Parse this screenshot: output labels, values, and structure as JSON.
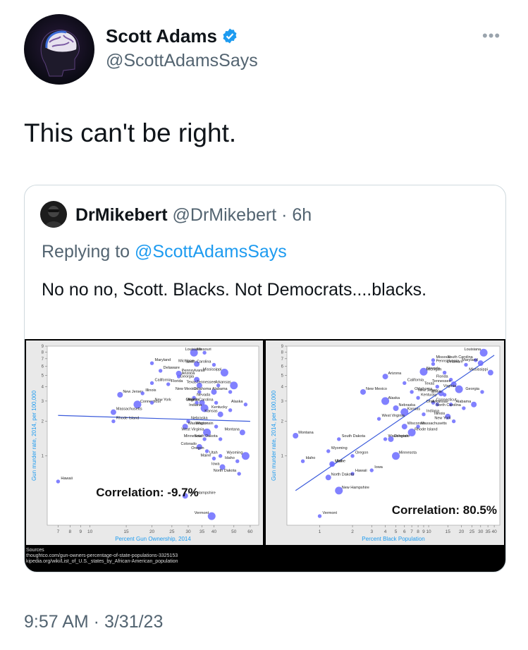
{
  "author": {
    "name": "Scott Adams",
    "handle": "@ScottAdamsSays"
  },
  "tweet": {
    "text": "This can't be right.",
    "timestamp": "9:57 AM · 3/31/23"
  },
  "more_label": "•••",
  "quote": {
    "name": "DrMikebert",
    "handle": "@DrMikebert · 6h",
    "reply_prefix": "Replying to ",
    "reply_mention": "@ScottAdamsSays",
    "text": "No no no, Scott. Blacks. Not Democrats....blacks."
  },
  "colors": {
    "accent": "#1d9bf0",
    "verified": "#1d9bf0",
    "point": "#6b6bff",
    "line": "#3b5bdb"
  },
  "sources": [
    "Sources",
    "thoughtco.com/gun-owners-percentage-of-state-populations-3325153",
    "kipedia.org/wiki/List_of_U.S._states_by_African-American_population"
  ],
  "chart_data": [
    {
      "type": "scatter",
      "xlabel": "Percent Gun Ownership, 2014",
      "ylabel": "Gun murder rate, 2014, per 100,000",
      "annotation": "Correlation: -9.7%",
      "x_ticks": [
        "7",
        "8",
        "9",
        "10",
        "15",
        "20",
        "25",
        "30",
        "35",
        "40",
        "50",
        "60"
      ],
      "y_ticks": [
        "1",
        "2",
        "3",
        "4",
        "5",
        "6",
        "7",
        "8",
        "9"
      ],
      "points": [
        {
          "label": "Missouri",
          "x": 32,
          "y": 7.9
        },
        {
          "label": "Louisiana",
          "x": 36,
          "y": 7.9
        },
        {
          "label": "Maryland",
          "x": 20,
          "y": 6.4
        },
        {
          "label": "Michigan",
          "x": 33,
          "y": 6.3
        },
        {
          "label": "South Carolina",
          "x": 40,
          "y": 6.2
        },
        {
          "label": "Delaware",
          "x": 22,
          "y": 5.5
        },
        {
          "label": "Pennsylvania",
          "x": 27,
          "y": 5.2
        },
        {
          "label": "Mississippi",
          "x": 45,
          "y": 5.3
        },
        {
          "label": "Arizona",
          "x": 27,
          "y": 4.9
        },
        {
          "label": "Georgia",
          "x": 33,
          "y": 4.6
        },
        {
          "label": "California",
          "x": 20,
          "y": 4.3
        },
        {
          "label": "Florida",
          "x": 24,
          "y": 4.2
        },
        {
          "label": "Texas",
          "x": 34,
          "y": 4.1
        },
        {
          "label": "Tennessee",
          "x": 42,
          "y": 4.1
        },
        {
          "label": "Arkansas",
          "x": 50,
          "y": 4.1
        },
        {
          "label": "New Jersey",
          "x": 14,
          "y": 3.4
        },
        {
          "label": "Illinois",
          "x": 18,
          "y": 3.5
        },
        {
          "label": "New Mexico",
          "x": 34,
          "y": 3.6
        },
        {
          "label": "Oklahoma",
          "x": 40,
          "y": 3.6
        },
        {
          "label": "Alabama",
          "x": 48,
          "y": 3.6
        },
        {
          "label": "Nevada",
          "x": 32,
          "y": 3.2
        },
        {
          "label": "Connecticut",
          "x": 17,
          "y": 2.8
        },
        {
          "label": "New York",
          "x": 20,
          "y": 2.9
        },
        {
          "label": "Ohio",
          "x": 33,
          "y": 2.9
        },
        {
          "label": "Virginia",
          "x": 35,
          "y": 2.9
        },
        {
          "label": "North Carolina",
          "x": 41,
          "y": 2.9
        },
        {
          "label": "Alaska",
          "x": 57,
          "y": 2.8
        },
        {
          "label": "Massachusetts",
          "x": 13,
          "y": 2.4
        },
        {
          "label": "Indiana",
          "x": 36,
          "y": 2.6
        },
        {
          "label": "Kentucky",
          "x": 48,
          "y": 2.5
        },
        {
          "label": "Kansas",
          "x": 43,
          "y": 2.3
        },
        {
          "label": "Rhode Island",
          "x": 13,
          "y": 2.0
        },
        {
          "label": "Nebraska",
          "x": 30,
          "y": 2.0
        },
        {
          "label": "Washington",
          "x": 29,
          "y": 1.8
        },
        {
          "label": "Wisconsin",
          "x": 41,
          "y": 1.8
        },
        {
          "label": "West Virginia",
          "x": 37,
          "y": 1.6
        },
        {
          "label": "Montana",
          "x": 55,
          "y": 1.6
        },
        {
          "label": "Minnesota",
          "x": 36,
          "y": 1.4
        },
        {
          "label": "South Dakota",
          "x": 43,
          "y": 1.4
        },
        {
          "label": "Colorado",
          "x": 34,
          "y": 1.2
        },
        {
          "label": "Oregon",
          "x": 37,
          "y": 1.1
        },
        {
          "label": "Utah",
          "x": 43,
          "y": 1.0
        },
        {
          "label": "Wyoming",
          "x": 57,
          "y": 1.0
        },
        {
          "label": "Maine",
          "x": 40,
          "y": 0.95
        },
        {
          "label": "Idaho",
          "x": 52,
          "y": 0.9
        },
        {
          "label": "Iowa",
          "x": 44,
          "y": 0.8
        },
        {
          "label": "North Dakota",
          "x": 53,
          "y": 0.7
        },
        {
          "label": "Hawaii",
          "x": 7,
          "y": 0.6
        },
        {
          "label": "New Hampshire",
          "x": 29,
          "y": 0.45
        },
        {
          "label": "Vermont",
          "x": 39,
          "y": 0.3
        }
      ],
      "trend": {
        "x": [
          7,
          60
        ],
        "y": [
          2.25,
          2.0
        ]
      }
    },
    {
      "type": "scatter",
      "xlabel": "Percent Black Population",
      "ylabel": "Gun murder rate, 2014, per 100,000",
      "annotation": "Correlation: 80.5%",
      "x_ticks": [
        "1",
        "2",
        "3",
        "4",
        "5",
        "6",
        "7",
        "8",
        "9",
        "10",
        "15",
        "20",
        "25",
        "30",
        "35",
        "40"
      ],
      "y_ticks": [
        "1",
        "2",
        "3",
        "4",
        "5",
        "6",
        "7",
        "8",
        "9"
      ],
      "points": [
        {
          "label": "Louisiana",
          "x": 32,
          "y": 7.9
        },
        {
          "label": "Missouri",
          "x": 11,
          "y": 6.8
        },
        {
          "label": "South Carolina",
          "x": 27,
          "y": 6.8
        },
        {
          "label": "Maryland",
          "x": 30,
          "y": 6.4
        },
        {
          "label": "Pennsylvania",
          "x": 11,
          "y": 6.3
        },
        {
          "label": "Delaware",
          "x": 22,
          "y": 6.2
        },
        {
          "label": "Mississippi",
          "x": 37,
          "y": 5.3
        },
        {
          "label": "Nevada",
          "x": 9,
          "y": 5.4
        },
        {
          "label": "Michigan",
          "x": 14,
          "y": 5.3
        },
        {
          "label": "Arizona",
          "x": 4,
          "y": 4.9
        },
        {
          "label": "California",
          "x": 6,
          "y": 4.3
        },
        {
          "label": "Florida",
          "x": 16,
          "y": 4.6
        },
        {
          "label": "Tennessee",
          "x": 17,
          "y": 4.2
        },
        {
          "label": "Texas",
          "x": 12,
          "y": 4.0
        },
        {
          "label": "Virginia",
          "x": 19,
          "y": 3.8
        },
        {
          "label": "New Mexico",
          "x": 2.5,
          "y": 3.6
        },
        {
          "label": "Oklahoma",
          "x": 7,
          "y": 3.6
        },
        {
          "label": "Georgia",
          "x": 31,
          "y": 3.6
        },
        {
          "label": "New Jersey",
          "x": 13,
          "y": 3.5
        },
        {
          "label": "Illinois",
          "x": 14,
          "y": 3.4
        },
        {
          "label": "Kentucky",
          "x": 8,
          "y": 3.2
        },
        {
          "label": "Alaska",
          "x": 4,
          "y": 3.0
        },
        {
          "label": "Connecticut",
          "x": 11,
          "y": 2.9
        },
        {
          "label": "Arkansas",
          "x": 16,
          "y": 2.8
        },
        {
          "label": "Alabama",
          "x": 26,
          "y": 2.8
        },
        {
          "label": "Ohio",
          "x": 12,
          "y": 2.8
        },
        {
          "label": "North Carolina",
          "x": 21,
          "y": 2.6
        },
        {
          "label": "Nebraska",
          "x": 5,
          "y": 2.6
        },
        {
          "label": "Kansas",
          "x": 6,
          "y": 2.4
        },
        {
          "label": "Indiana",
          "x": 9,
          "y": 2.3
        },
        {
          "label": "Illinois",
          "x": 15,
          "y": 2.2
        },
        {
          "label": "West Virginia",
          "x": 3.5,
          "y": 2.1
        },
        {
          "label": "New York",
          "x": 17,
          "y": 2.0
        },
        {
          "label": "Wisconsin",
          "x": 6,
          "y": 1.8
        },
        {
          "label": "Massachusetts",
          "x": 8,
          "y": 1.8
        },
        {
          "label": "Rhode Island",
          "x": 7,
          "y": 1.6
        },
        {
          "label": "Montana",
          "x": 0.6,
          "y": 1.5
        },
        {
          "label": "South Dakota",
          "x": 1.5,
          "y": 1.4
        },
        {
          "label": "Washington",
          "x": 4,
          "y": 1.4
        },
        {
          "label": "Colorado",
          "x": 4.5,
          "y": 1.4
        },
        {
          "label": "Wyoming",
          "x": 1.2,
          "y": 1.1
        },
        {
          "label": "Oregon",
          "x": 2,
          "y": 1.0
        },
        {
          "label": "Minnesota",
          "x": 5,
          "y": 1.0
        },
        {
          "label": "Idaho",
          "x": 0.7,
          "y": 0.9
        },
        {
          "label": "Maine",
          "x": 1.3,
          "y": 0.85
        },
        {
          "label": "Utah",
          "x": 1.3,
          "y": 0.85
        },
        {
          "label": "Iowa",
          "x": 3,
          "y": 0.75
        },
        {
          "label": "Hawaii",
          "x": 2,
          "y": 0.7
        },
        {
          "label": "North Dakota",
          "x": 1.2,
          "y": 0.65
        },
        {
          "label": "New Hampshire",
          "x": 1.5,
          "y": 0.5
        },
        {
          "label": "Vermont",
          "x": 1,
          "y": 0.3
        }
      ],
      "trend": {
        "x": [
          0.6,
          40
        ],
        "y": [
          0.5,
          7.5
        ]
      }
    }
  ]
}
